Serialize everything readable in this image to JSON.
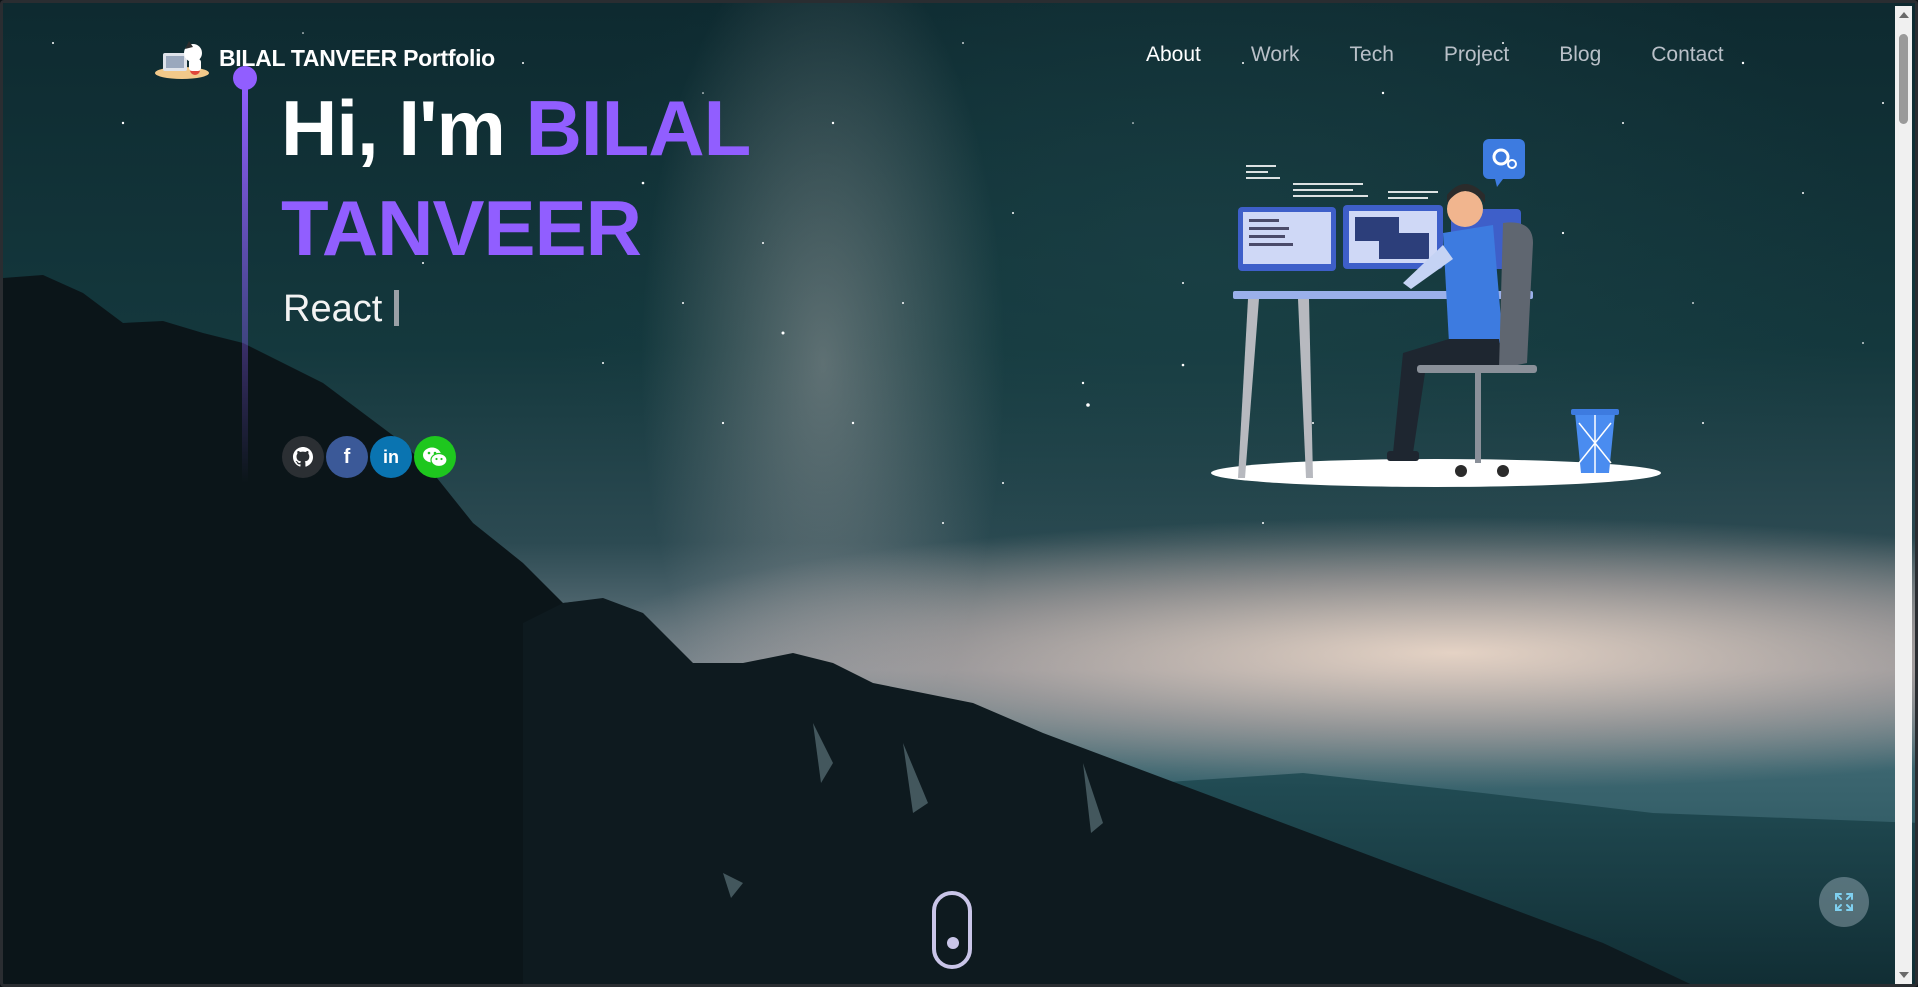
{
  "header": {
    "brand_name": "BILAL TANVEER Portfolio",
    "nav": [
      {
        "label": "About",
        "active": true
      },
      {
        "label": "Work",
        "active": false
      },
      {
        "label": "Tech",
        "active": false
      },
      {
        "label": "Project",
        "active": false
      },
      {
        "label": "Blog",
        "active": false
      },
      {
        "label": "Contact",
        "active": false
      }
    ]
  },
  "hero": {
    "greeting": "Hi, I'm",
    "name_first": "BILAL",
    "name_last": "TANVEER",
    "typed_text": "React"
  },
  "socials": [
    {
      "name": "github",
      "icon": "github-icon",
      "glyph": "",
      "color": "#2b2f33"
    },
    {
      "name": "facebook",
      "icon": "facebook-icon",
      "glyph": "f",
      "color": "#3b5998"
    },
    {
      "name": "linkedin",
      "icon": "linkedin-icon",
      "glyph": "in",
      "color": "#0a74b1"
    },
    {
      "name": "wechat",
      "icon": "wechat-icon",
      "glyph": "",
      "color": "#1ec71e"
    }
  ],
  "colors": {
    "accent": "#915eff",
    "text": "#ffffff",
    "nav_inactive": "#b9c0c8"
  }
}
